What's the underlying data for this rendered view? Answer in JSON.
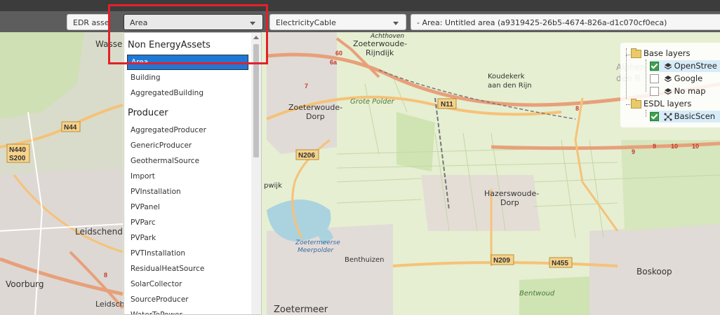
{
  "toolbar": {
    "asset_button": "EDR asset",
    "asset_type_select": "Area",
    "cable_select": "ElectricityCable",
    "area_select": "- Area: Untitled area (a9319425-26b5-4674-826a-d1c070cf0eca)"
  },
  "dropdown": {
    "groups": [
      {
        "label": "Non EnergyAssets",
        "items": [
          "Area",
          "Building",
          "AggregatedBuilding"
        ]
      },
      {
        "label": "Producer",
        "items": [
          "AggregatedProducer",
          "GenericProducer",
          "GeothermalSource",
          "Import",
          "PVInstallation",
          "PVPanel",
          "PVParc",
          "PVPark",
          "PVTInstallation",
          "ResidualHeatSource",
          "SolarCollector",
          "SourceProducer",
          "WaterToPower"
        ]
      }
    ],
    "selected": "Area"
  },
  "layers": {
    "base_group": "Base layers",
    "base_items": [
      {
        "label": "OpenStree",
        "checked": true
      },
      {
        "label": "Google",
        "checked": false
      },
      {
        "label": "No map",
        "checked": false
      }
    ],
    "esdl_group": "ESDL layers",
    "esdl_items": [
      {
        "label": "BasicScen",
        "checked": true
      }
    ]
  },
  "map": {
    "places": [
      "Wasse",
      "Zoeterwoude-Rijndijk",
      "Koudekerk",
      "aan den Rijn",
      "Zoeterwoude-",
      "Dorp",
      "Grote Polder",
      "Hazerswoude-",
      "Dorp",
      "Leidschend",
      "Voorburg",
      "Leidsch",
      "Benthuizen",
      "Zoetermeerse",
      "Meerpolder",
      "Zoetermeer",
      "Boskoop",
      "Bentwoud",
      "Alphen",
      "den R",
      "pwijk",
      "Achthoven"
    ],
    "roads": [
      "N11",
      "N44",
      "N440",
      "S200",
      "N206",
      "N209",
      "N455",
      "60",
      "6a",
      "7",
      "9",
      "10",
      "8"
    ]
  },
  "colors": {
    "highlight": "#e3202a",
    "selected_item": "#1e78d6",
    "checkbox_checked": "#3fa14b"
  }
}
